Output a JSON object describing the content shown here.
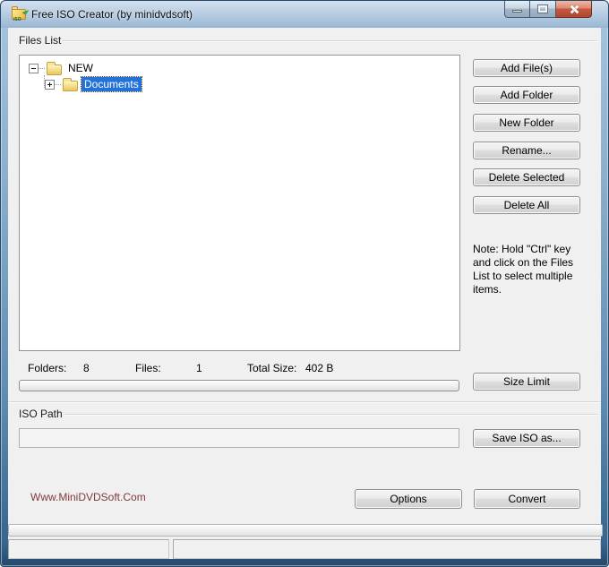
{
  "window": {
    "title": "Free ISO Creator (by minidvdsoft)"
  },
  "files_list": {
    "group_label": "Files List",
    "tree": {
      "root": {
        "label": "NEW",
        "state": "expanded"
      },
      "child": {
        "label": "Documents",
        "state": "collapsed",
        "selected": true
      }
    },
    "action_buttons": {
      "add_files": "Add File(s)",
      "add_folder": "Add Folder",
      "new_folder": "New Folder",
      "rename": "Rename...",
      "delete_selected": "Delete Selected",
      "delete_all": "Delete All"
    },
    "note": "Note: Hold \"Ctrl\" key and click on the Files List to select multiple items.",
    "stats": {
      "folders_label": "Folders:",
      "folders_value": "8",
      "files_label": "Files:",
      "files_value": "1",
      "total_size_label": "Total Size:",
      "total_size_value": "402 B"
    },
    "size_limit_button": "Size Limit"
  },
  "iso_path": {
    "group_label": "ISO Path",
    "path_value": "",
    "save_iso_button": "Save ISO as..."
  },
  "footer": {
    "website_link": "Www.MiniDVDSoft.Com",
    "options_button": "Options",
    "convert_button": "Convert"
  },
  "colors": {
    "selection_blue": "#2272d8",
    "website_red": "#7f3a3a",
    "titlebar_blue": "#a9c4de",
    "close_button_red": "#c75a3e",
    "client_background": "#f0f0f0"
  }
}
